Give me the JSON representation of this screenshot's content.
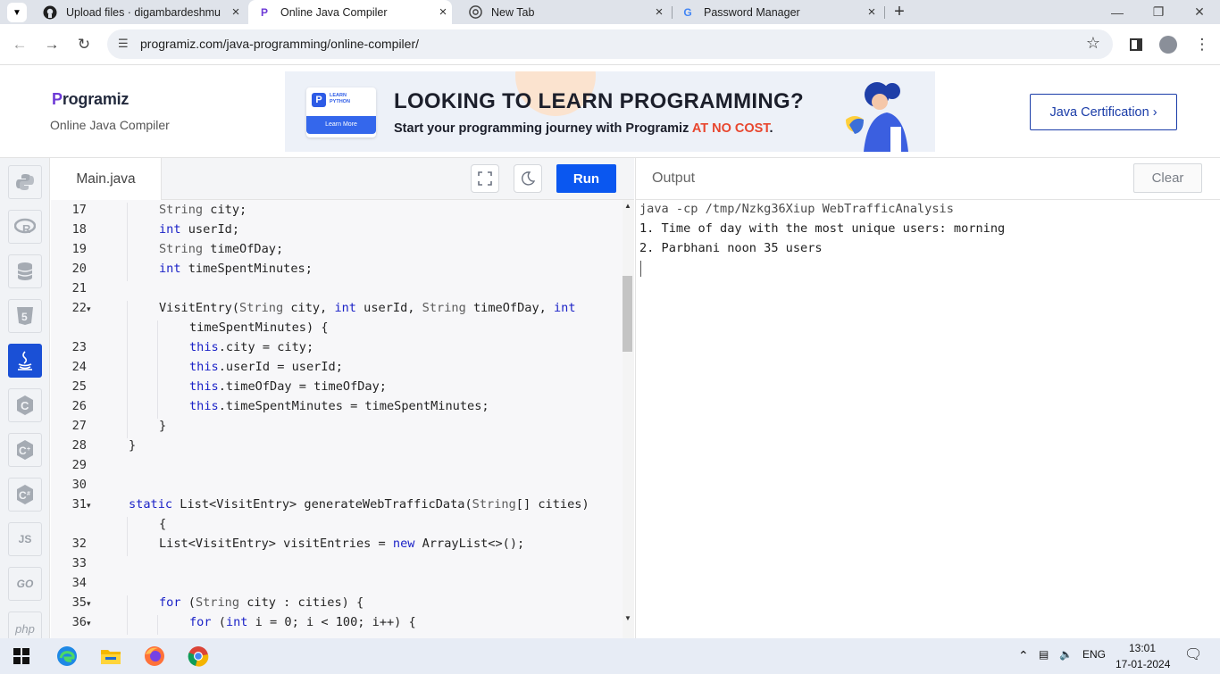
{
  "browser": {
    "tabs": [
      {
        "title": "Upload files · digambardeshmu",
        "icon": "github-icon"
      },
      {
        "title": "Online Java Compiler",
        "icon": "programiz-icon"
      },
      {
        "title": "New Tab",
        "icon": "chrome-icon"
      },
      {
        "title": "Password Manager",
        "icon": "google-icon"
      }
    ],
    "url": "programiz.com/java-programming/online-compiler/"
  },
  "header": {
    "logo_p": "P",
    "logo_rest": "rogramiz",
    "subtitle": "Online Java Compiler",
    "cert_button": "Java Certification ›"
  },
  "banner": {
    "badge_line1": "LEARN",
    "badge_line2": "PYTHON",
    "learn_more": "Learn More",
    "headline": "LOOKING TO LEARN PROGRAMMING?",
    "sub_before": "Start your programming journey with Programiz ",
    "sub_highlight": "AT NO COST",
    "sub_after": "."
  },
  "sidebar": {
    "items": [
      "python-icon",
      "r-icon",
      "sql-icon",
      "html-icon",
      "java-icon",
      "c-icon",
      "cpp-icon",
      "csharp-icon",
      "JS",
      "GO",
      "php"
    ]
  },
  "editor": {
    "file_tab": "Main.java",
    "run_label": "Run",
    "lines": [
      {
        "n": "17",
        "fold": false,
        "indent": 1,
        "parts": [
          [
            "ty",
            "String"
          ],
          [
            "",
            "city;"
          ]
        ]
      },
      {
        "n": "18",
        "fold": false,
        "indent": 1,
        "parts": [
          [
            "kw",
            "int"
          ],
          [
            "",
            "userId;"
          ]
        ]
      },
      {
        "n": "19",
        "fold": false,
        "indent": 1,
        "parts": [
          [
            "ty",
            "String"
          ],
          [
            "",
            "timeOfDay;"
          ]
        ]
      },
      {
        "n": "20",
        "fold": false,
        "indent": 1,
        "parts": [
          [
            "kw",
            "int"
          ],
          [
            "",
            "timeSpentMinutes;"
          ]
        ]
      },
      {
        "n": "21",
        "fold": false,
        "indent": 0,
        "parts": []
      },
      {
        "n": "22",
        "fold": true,
        "indent": 1,
        "parts": [
          [
            "",
            "VisitEntry("
          ],
          [
            "ty",
            "String"
          ],
          [
            "",
            " city, "
          ],
          [
            "kw",
            "int"
          ],
          [
            "",
            " userId, "
          ],
          [
            "ty",
            "String"
          ],
          [
            "",
            " timeOfDay, "
          ],
          [
            "kw",
            "int"
          ]
        ]
      },
      {
        "n": "",
        "fold": false,
        "indent": 2,
        "parts": [
          [
            "",
            "timeSpentMinutes) {"
          ]
        ]
      },
      {
        "n": "23",
        "fold": false,
        "indent": 2,
        "parts": [
          [
            "kw",
            "this"
          ],
          [
            "",
            ".city = city;"
          ]
        ]
      },
      {
        "n": "24",
        "fold": false,
        "indent": 2,
        "parts": [
          [
            "kw",
            "this"
          ],
          [
            "",
            ".userId = userId;"
          ]
        ]
      },
      {
        "n": "25",
        "fold": false,
        "indent": 2,
        "parts": [
          [
            "kw",
            "this"
          ],
          [
            "",
            ".timeOfDay = timeOfDay;"
          ]
        ]
      },
      {
        "n": "26",
        "fold": false,
        "indent": 2,
        "parts": [
          [
            "kw",
            "this"
          ],
          [
            "",
            ".timeSpentMinutes = timeSpentMinutes;"
          ]
        ]
      },
      {
        "n": "27",
        "fold": false,
        "indent": 1,
        "parts": [
          [
            "",
            "}"
          ]
        ]
      },
      {
        "n": "28",
        "fold": false,
        "indent": 0,
        "parts": [
          [
            "",
            "}"
          ]
        ]
      },
      {
        "n": "29",
        "fold": false,
        "indent": 0,
        "parts": []
      },
      {
        "n": "30",
        "fold": false,
        "indent": 0,
        "parts": []
      },
      {
        "n": "31",
        "fold": true,
        "indent": 0,
        "parts": [
          [
            "kw",
            "static"
          ],
          [
            "",
            " List<VisitEntry> generateWebTrafficData("
          ],
          [
            "ty",
            "String"
          ],
          [
            "",
            "[] cities)"
          ]
        ]
      },
      {
        "n": "",
        "fold": false,
        "indent": 1,
        "parts": [
          [
            "",
            "{"
          ]
        ]
      },
      {
        "n": "32",
        "fold": false,
        "indent": 1,
        "parts": [
          [
            "",
            "List<VisitEntry> visitEntries = "
          ],
          [
            "kw",
            "new"
          ],
          [
            "",
            " ArrayList<>();"
          ]
        ]
      },
      {
        "n": "33",
        "fold": false,
        "indent": 0,
        "parts": []
      },
      {
        "n": "34",
        "fold": false,
        "indent": 0,
        "parts": []
      },
      {
        "n": "35",
        "fold": true,
        "indent": 1,
        "parts": [
          [
            "kw",
            "for"
          ],
          [
            "",
            " ("
          ],
          [
            "ty",
            "String"
          ],
          [
            "",
            " city : cities) {"
          ]
        ]
      },
      {
        "n": "36",
        "fold": true,
        "indent": 2,
        "parts": [
          [
            "kw",
            "for"
          ],
          [
            "",
            " ("
          ],
          [
            "kw",
            "int"
          ],
          [
            "",
            " i = 0; i < 100; i++) {"
          ]
        ]
      }
    ]
  },
  "output": {
    "label": "Output",
    "clear_label": "Clear",
    "lines": [
      "java -cp /tmp/Nzkg36Xiup WebTrafficAnalysis",
      "1. Time of day with the most unique users: morning",
      "2. Parbhani noon 35 users"
    ]
  },
  "taskbar": {
    "lang": "ENG",
    "time": "13:01",
    "date": "17-01-2024"
  },
  "colors": {
    "run": "#0a57f0",
    "java_active": "#1a50d6",
    "keyword": "#1c23c7",
    "free_highlight": "#e8462e"
  }
}
